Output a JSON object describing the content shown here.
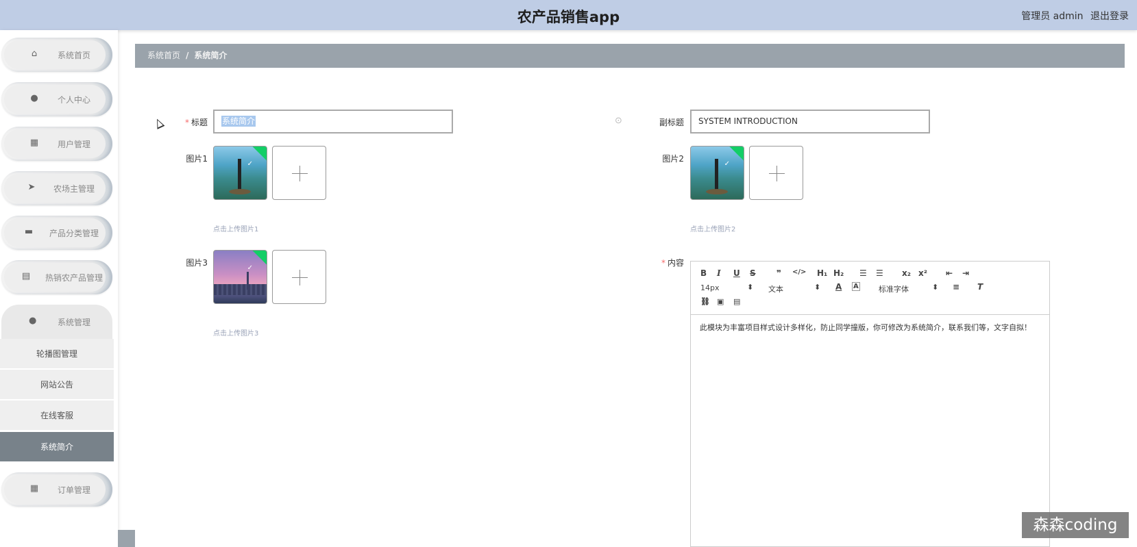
{
  "header": {
    "title": "农产品销售app",
    "user_role": "管理员 admin",
    "logout_label": "退出登录"
  },
  "sidebar": {
    "items": [
      {
        "label": "系统首页",
        "icon": "home-icon"
      },
      {
        "label": "个人中心",
        "icon": "user-icon"
      },
      {
        "label": "用户管理",
        "icon": "grid-icon"
      },
      {
        "label": "农场主管理",
        "icon": "send-icon"
      },
      {
        "label": "产品分类管理",
        "icon": "chat-icon"
      },
      {
        "label": "热销农产品管理",
        "icon": "doc-icon"
      },
      {
        "label": "系统管理",
        "icon": "user-icon"
      },
      {
        "label": "订单管理",
        "icon": "grid-icon"
      }
    ],
    "submenu": [
      {
        "label": "轮播图管理"
      },
      {
        "label": "网站公告"
      },
      {
        "label": "在线客服"
      },
      {
        "label": "系统简介",
        "active": true
      }
    ]
  },
  "breadcrumb": {
    "home": "系统首页",
    "separator": "/",
    "current": "系统简介"
  },
  "form": {
    "title_label": "标题",
    "title_value": "系统简介",
    "subtitle_label": "副标题",
    "subtitle_value": "SYSTEM INTRODUCTION",
    "image1_label": "图片1",
    "image1_tip": "点击上传图片1",
    "image2_label": "图片2",
    "image2_tip": "点击上传图片2",
    "image3_label": "图片3",
    "image3_tip": "点击上传图片3",
    "content_label": "内容",
    "required_mark": "*"
  },
  "editor": {
    "font_size": "14px",
    "block_type": "文本",
    "font_family": "标准字体",
    "content": "此模块为丰富项目样式设计多样化，防止同学撞版，你可修改为系统简介，联系我们等，文字自拟！"
  },
  "watermark": "森森coding",
  "colors": {
    "topbar": "#bfcde5",
    "breadcrumb": "#9aa3ab",
    "active_menu": "#78828a",
    "upload_success": "#13ce66",
    "required": "#f56c6c"
  }
}
